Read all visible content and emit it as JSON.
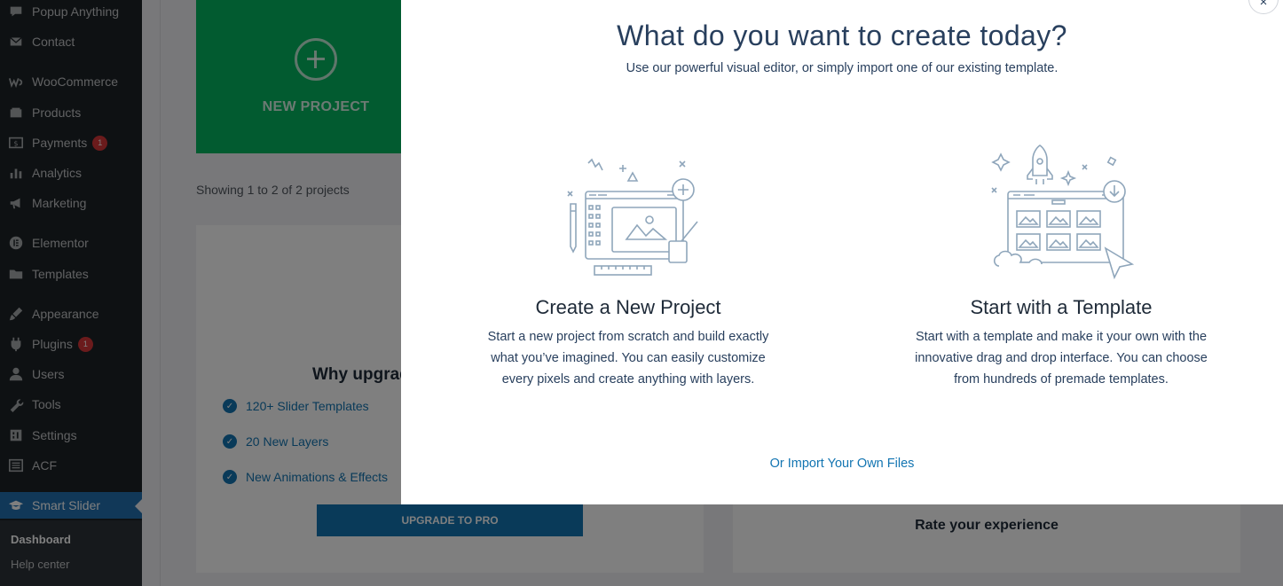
{
  "sidebar": {
    "items": [
      {
        "label": "Popup Anything",
        "icon": "popup-icon"
      },
      {
        "label": "Contact",
        "icon": "mail-icon"
      },
      {
        "label": "WooCommerce",
        "icon": "woocommerce-icon"
      },
      {
        "label": "Products",
        "icon": "products-icon"
      },
      {
        "label": "Payments",
        "icon": "payments-icon",
        "badge": "1"
      },
      {
        "label": "Analytics",
        "icon": "analytics-icon"
      },
      {
        "label": "Marketing",
        "icon": "marketing-icon"
      },
      {
        "label": "Elementor",
        "icon": "elementor-icon"
      },
      {
        "label": "Templates",
        "icon": "folder-icon"
      },
      {
        "label": "Appearance",
        "icon": "appearance-icon"
      },
      {
        "label": "Plugins",
        "icon": "plugins-icon",
        "badge": "1"
      },
      {
        "label": "Users",
        "icon": "users-icon"
      },
      {
        "label": "Tools",
        "icon": "tools-icon"
      },
      {
        "label": "Settings",
        "icon": "settings-icon"
      },
      {
        "label": "ACF",
        "icon": "acf-icon"
      },
      {
        "label": "Smart Slider",
        "icon": "smart-slider-icon"
      }
    ],
    "submenu": [
      "Dashboard",
      "Help center"
    ]
  },
  "content": {
    "new_project_label": "NEW PROJECT",
    "showing_text": "Showing 1 to 2 of 2 projects",
    "upgrade": {
      "title": "Why upgrad",
      "features": [
        "120+ Slider Templates",
        "20 New Layers",
        "New Animations & Effects"
      ],
      "button": "UPGRADE TO PRO"
    },
    "rate_text": "Rate your experience"
  },
  "modal": {
    "close_label": "×",
    "title": "What do you want to create today?",
    "subtitle": "Use our powerful visual editor, or simply import one of our existing template.",
    "options": [
      {
        "title": "Create a New Project",
        "desc_lines": [
          "Start a new project from scratch and build exactly",
          "what you’ve imagined. You can easily customize",
          "every pixels and create anything with layers."
        ]
      },
      {
        "title": "Start with a Template",
        "desc_lines": [
          "Start with a template and make it your own with the",
          "innovative drag and drop interface. You can choose",
          "from hundreds of premade templates."
        ]
      }
    ],
    "import_link": "Or Import Your Own Files"
  },
  "colors": {
    "sidebar_bg": "#1d2327",
    "accent": "#2271b1",
    "brand_blue": "#1375b2",
    "new_project_green": "#04b661",
    "modal_text": "#283f5d",
    "illustration_stroke": "#8fa6bb"
  }
}
